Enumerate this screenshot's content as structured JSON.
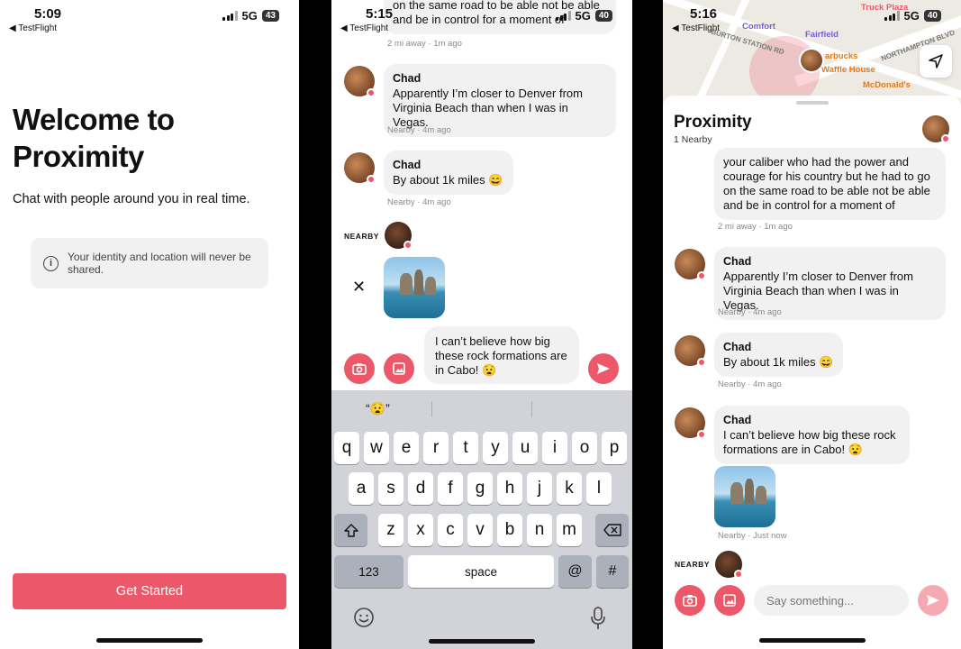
{
  "screen1": {
    "status": {
      "time": "5:09",
      "back": "◀ TestFlight",
      "network": "5G",
      "battery": "43"
    },
    "title_line1": "Welcome to",
    "title_line2": "Proximity",
    "subtitle": "Chat with people around you in real time.",
    "notice": "Your identity and location will never be shared.",
    "cta": "Get Started"
  },
  "screen2": {
    "status": {
      "time": "5:15",
      "back": "◀ TestFlight",
      "network": "5G",
      "battery": "40"
    },
    "top_bubble_line1": "on the same road to be able not be able",
    "top_bubble_line2": "and be in control for a moment of",
    "top_meta": "2 mi away  · 1m ago",
    "messages": [
      {
        "name": "Chad",
        "text": "Apparently I’m closer to Denver from Virginia Beach than when I was in Vegas.",
        "meta": "Nearby  · 4m ago"
      },
      {
        "name": "Chad",
        "text": "By about 1k miles 😄",
        "meta": "Nearby  · 4m ago"
      }
    ],
    "nearby_label": "NEARBY",
    "remove_icon": "✕",
    "draft_text": "I can’t believe how big these rock formations are in Cabo! 😧",
    "suggestion": "“😧”",
    "keys_row1": [
      "q",
      "w",
      "e",
      "r",
      "t",
      "y",
      "u",
      "i",
      "o",
      "p"
    ],
    "keys_row2": [
      "a",
      "s",
      "d",
      "f",
      "g",
      "h",
      "j",
      "k",
      "l"
    ],
    "keys_row3": [
      "z",
      "x",
      "c",
      "v",
      "b",
      "n",
      "m"
    ],
    "key_123": "123",
    "key_space": "space",
    "key_at": "@",
    "key_hash": "#"
  },
  "screen3": {
    "status": {
      "time": "5:16",
      "back": "◀ TestFlight",
      "network": "5G",
      "battery": "40"
    },
    "map_pois": [
      "Comfort",
      "Fairfield",
      "Truck Plaza",
      "arbucks",
      "Waffle House",
      "McDonald's",
      "BURTON STATION RD",
      "NORTHAMPTON BLVD"
    ],
    "title": "Proximity",
    "subtitle": "1 Nearby",
    "top_bubble": "your caliber who had the power and courage for his country but he had to go on the same road to be able not be able and be in control for a moment of",
    "top_meta": "2 mi away  · 1m ago",
    "messages": [
      {
        "name": "Chad",
        "text": "Apparently I’m closer to Denver from Virginia Beach than when I was in Vegas.",
        "meta": "Nearby  · 4m ago"
      },
      {
        "name": "Chad",
        "text": "By about 1k miles 😄",
        "meta": "Nearby  · 4m ago"
      },
      {
        "name": "Chad",
        "text": "I can’t believe how big these rock formations are in Cabo! 😧",
        "meta": "Nearby  · Just now"
      }
    ],
    "nearby_label": "NEARBY",
    "input_placeholder": "Say something..."
  },
  "colors": {
    "accent": "#ec5869",
    "bubble": "#f1f1f1",
    "keyboard": "#d1d3d9"
  }
}
